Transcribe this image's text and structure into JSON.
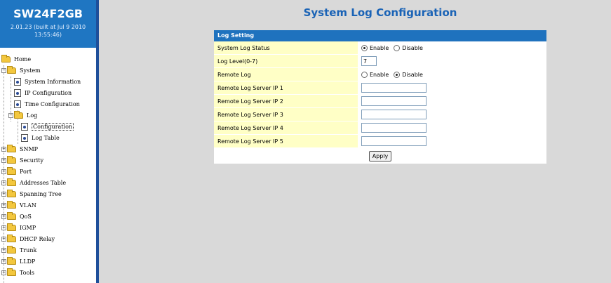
{
  "brand": {
    "name": "SW24F2GB",
    "version_line1": "2.01.23 (built at Jul 9 2010",
    "version_line2": "13:55:46)"
  },
  "tree": {
    "home": "Home",
    "system": "System",
    "system_information": "System Information",
    "ip_configuration": "IP Configuration",
    "time_configuration": "Time Configuration",
    "log": "Log",
    "log_configuration": "Configuration",
    "log_table": "Log Table",
    "snmp": "SNMP",
    "security": "Security",
    "port": "Port",
    "addresses_table": "Addresses Table",
    "spanning_tree": "Spanning Tree",
    "vlan": "VLAN",
    "qos": "QoS",
    "igmp": "IGMP",
    "dhcp_relay": "DHCP Relay",
    "trunk": "Trunk",
    "lldp": "LLDP",
    "tools": "Tools"
  },
  "page": {
    "title": "System Log Configuration",
    "section_header": "Log Setting"
  },
  "form": {
    "status_label": "System Log Status",
    "status_enable": "Enable",
    "status_disable": "Disable",
    "status_selected": "Enable",
    "level_label": "Log Level(0-7)",
    "level_value": "7",
    "remote_label": "Remote Log",
    "remote_enable": "Enable",
    "remote_disable": "Disable",
    "remote_selected": "Disable",
    "server1_label": "Remote Log Server IP 1",
    "server1_value": "",
    "server2_label": "Remote Log Server IP 2",
    "server2_value": "",
    "server3_label": "Remote Log Server IP 3",
    "server3_value": "",
    "server4_label": "Remote Log Server IP 4",
    "server4_value": "",
    "server5_label": "Remote Log Server IP 5",
    "server5_value": "",
    "apply_label": "Apply"
  },
  "colors": {
    "brand_bg": "#1f76c2",
    "title": "#1a63b6",
    "header_bg": "#1f72be",
    "label_bg": "#ffffc6",
    "content_bg": "#d9d9d9"
  },
  "icons": {
    "folder": "folder-icon",
    "page": "page-icon",
    "expand": "expand-icon",
    "collapse": "collapse-icon"
  }
}
